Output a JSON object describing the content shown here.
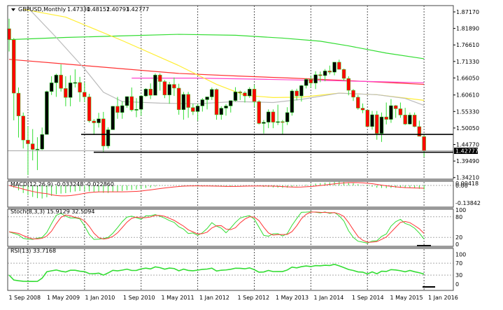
{
  "header": {
    "symbol": "GBPUSD,Monthly",
    "open": "1.47330",
    "high": "1.48152",
    "low": "1.40793",
    "close": "1.42777"
  },
  "current_price_label": "1.42777",
  "colors": {
    "bull_body": "#000000",
    "bear_body": "#ff0000",
    "wick": "#33dd33",
    "ma_green": "#33dd33",
    "ma_red": "#ff3333",
    "ma_pink": "#ff44cc",
    "ma_yellow": "#ffee33",
    "ma_gray": "#bbbbbb"
  },
  "chart_data": {
    "type": "candlestick",
    "title": "GBPUSD,Monthly",
    "price_ticks": [
      "1.87170",
      "1.81890",
      "1.76610",
      "1.71330",
      "1.66050",
      "1.60610",
      "1.55330",
      "1.50050",
      "1.44770",
      "1.39490",
      "1.34210"
    ],
    "price_tick_values": [
      1.8717,
      1.8189,
      1.7661,
      1.7133,
      1.6605,
      1.6061,
      1.5533,
      1.5005,
      1.4477,
      1.3949,
      1.3421
    ],
    "date_labels": [
      "1 Sep 2008",
      "1 May 2009",
      "1 Jan 2010",
      "1 Sep 2010",
      "1 May 2011",
      "1 Jan 2012",
      "1 Sep 2012",
      "1 May 2013",
      "1 Jan 2014",
      "1 Sep 2014",
      "1 May 2015",
      "1 Jan 2016"
    ],
    "first_bar": "2008-09",
    "ohlc": [
      [
        1.818,
        1.85,
        1.745,
        1.783
      ],
      [
        1.783,
        1.788,
        1.525,
        1.612
      ],
      [
        1.612,
        1.63,
        1.47,
        1.539
      ],
      [
        1.539,
        1.55,
        1.435,
        1.462
      ],
      [
        1.462,
        1.505,
        1.35,
        1.45
      ],
      [
        1.45,
        1.497,
        1.397,
        1.432
      ],
      [
        1.432,
        1.471,
        1.366,
        1.433
      ],
      [
        1.433,
        1.502,
        1.43,
        1.48
      ],
      [
        1.48,
        1.62,
        1.48,
        1.617
      ],
      [
        1.617,
        1.666,
        1.606,
        1.645
      ],
      [
        1.645,
        1.674,
        1.6,
        1.67
      ],
      [
        1.67,
        1.704,
        1.617,
        1.627
      ],
      [
        1.627,
        1.666,
        1.57,
        1.598
      ],
      [
        1.598,
        1.669,
        1.57,
        1.645
      ],
      [
        1.645,
        1.688,
        1.63,
        1.646
      ],
      [
        1.646,
        1.664,
        1.584,
        1.615
      ],
      [
        1.615,
        1.646,
        1.583,
        1.6
      ],
      [
        1.6,
        1.61,
        1.518,
        1.523
      ],
      [
        1.523,
        1.529,
        1.478,
        1.517
      ],
      [
        1.517,
        1.549,
        1.502,
        1.53
      ],
      [
        1.53,
        1.552,
        1.423,
        1.443
      ],
      [
        1.443,
        1.503,
        1.435,
        1.495
      ],
      [
        1.495,
        1.571,
        1.495,
        1.57
      ],
      [
        1.57,
        1.6,
        1.53,
        1.55
      ],
      [
        1.55,
        1.586,
        1.53,
        1.572
      ],
      [
        1.572,
        1.6,
        1.565,
        1.601
      ],
      [
        1.601,
        1.63,
        1.553,
        1.558
      ],
      [
        1.558,
        1.596,
        1.535,
        1.56
      ],
      [
        1.56,
        1.606,
        1.54,
        1.603
      ],
      [
        1.603,
        1.628,
        1.6,
        1.625
      ],
      [
        1.625,
        1.643,
        1.593,
        1.605
      ],
      [
        1.605,
        1.675,
        1.605,
        1.67
      ],
      [
        1.67,
        1.675,
        1.62,
        1.649
      ],
      [
        1.649,
        1.654,
        1.596,
        1.606
      ],
      [
        1.606,
        1.648,
        1.578,
        1.64
      ],
      [
        1.64,
        1.662,
        1.603,
        1.628
      ],
      [
        1.628,
        1.642,
        1.543,
        1.559
      ],
      [
        1.559,
        1.616,
        1.527,
        1.608
      ],
      [
        1.608,
        1.616,
        1.533,
        1.566
      ],
      [
        1.566,
        1.578,
        1.542,
        1.553
      ],
      [
        1.553,
        1.578,
        1.524,
        1.571
      ],
      [
        1.571,
        1.596,
        1.553,
        1.591
      ],
      [
        1.591,
        1.6,
        1.56,
        1.6
      ],
      [
        1.6,
        1.63,
        1.59,
        1.624
      ],
      [
        1.624,
        1.627,
        1.527,
        1.543
      ],
      [
        1.543,
        1.57,
        1.527,
        1.564
      ],
      [
        1.564,
        1.577,
        1.54,
        1.571
      ],
      [
        1.571,
        1.589,
        1.55,
        1.588
      ],
      [
        1.588,
        1.631,
        1.585,
        1.616
      ],
      [
        1.616,
        1.62,
        1.59,
        1.613
      ],
      [
        1.613,
        1.618,
        1.582,
        1.603
      ],
      [
        1.603,
        1.631,
        1.597,
        1.625
      ],
      [
        1.625,
        1.638,
        1.569,
        1.585
      ],
      [
        1.585,
        1.589,
        1.512,
        1.515
      ],
      [
        1.515,
        1.526,
        1.483,
        1.519
      ],
      [
        1.519,
        1.56,
        1.5,
        1.552
      ],
      [
        1.552,
        1.56,
        1.5,
        1.519
      ],
      [
        1.519,
        1.575,
        1.51,
        1.521
      ],
      [
        1.521,
        1.526,
        1.481,
        1.52
      ],
      [
        1.52,
        1.567,
        1.51,
        1.55
      ],
      [
        1.55,
        1.624,
        1.54,
        1.619
      ],
      [
        1.619,
        1.626,
        1.589,
        1.603
      ],
      [
        1.603,
        1.638,
        1.585,
        1.636
      ],
      [
        1.636,
        1.66,
        1.627,
        1.656
      ],
      [
        1.656,
        1.667,
        1.63,
        1.644
      ],
      [
        1.644,
        1.682,
        1.625,
        1.671
      ],
      [
        1.671,
        1.681,
        1.647,
        1.668
      ],
      [
        1.668,
        1.689,
        1.65,
        1.683
      ],
      [
        1.683,
        1.7,
        1.672,
        1.679
      ],
      [
        1.679,
        1.711,
        1.669,
        1.711
      ],
      [
        1.711,
        1.719,
        1.688,
        1.688
      ],
      [
        1.688,
        1.69,
        1.652,
        1.659
      ],
      [
        1.659,
        1.666,
        1.605,
        1.621
      ],
      [
        1.621,
        1.625,
        1.587,
        1.599
      ],
      [
        1.599,
        1.606,
        1.559,
        1.564
      ],
      [
        1.564,
        1.579,
        1.548,
        1.558
      ],
      [
        1.558,
        1.558,
        1.504,
        1.505
      ],
      [
        1.505,
        1.555,
        1.495,
        1.543
      ],
      [
        1.543,
        1.555,
        1.463,
        1.483
      ],
      [
        1.483,
        1.55,
        1.456,
        1.536
      ],
      [
        1.536,
        1.582,
        1.512,
        1.528
      ],
      [
        1.528,
        1.593,
        1.517,
        1.572
      ],
      [
        1.572,
        1.574,
        1.533,
        1.562
      ],
      [
        1.562,
        1.582,
        1.533,
        1.542
      ],
      [
        1.542,
        1.565,
        1.51,
        1.513
      ],
      [
        1.513,
        1.55,
        1.511,
        1.542
      ],
      [
        1.542,
        1.55,
        1.503,
        1.505
      ],
      [
        1.505,
        1.524,
        1.475,
        1.474
      ],
      [
        1.4733,
        1.48152,
        1.40793,
        1.42777
      ]
    ],
    "moving_averages": [
      {
        "name": "ma-green",
        "color": "#33dd33",
        "points": [
          [
            0,
            1.783
          ],
          [
            12,
            1.79
          ],
          [
            24,
            1.795
          ],
          [
            36,
            1.8
          ],
          [
            48,
            1.797
          ],
          [
            58,
            1.788
          ],
          [
            66,
            1.778
          ],
          [
            72,
            1.763
          ],
          [
            80,
            1.74
          ],
          [
            88,
            1.722
          ]
        ]
      },
      {
        "name": "ma-red",
        "color": "#ff3333",
        "points": [
          [
            0,
            1.72
          ],
          [
            12,
            1.705
          ],
          [
            24,
            1.69
          ],
          [
            36,
            1.675
          ],
          [
            48,
            1.667
          ],
          [
            60,
            1.66
          ],
          [
            72,
            1.652
          ],
          [
            80,
            1.646
          ],
          [
            88,
            1.64
          ]
        ]
      },
      {
        "name": "ma-pink",
        "color": "#ff44cc",
        "points": [
          [
            26,
            1.66
          ],
          [
            40,
            1.66
          ],
          [
            55,
            1.656
          ],
          [
            68,
            1.652
          ],
          [
            80,
            1.648
          ],
          [
            88,
            1.645
          ]
        ]
      },
      {
        "name": "ma-yellow",
        "color": "#ffee33",
        "points": [
          [
            3,
            1.88
          ],
          [
            12,
            1.855
          ],
          [
            24,
            1.78
          ],
          [
            36,
            1.7
          ],
          [
            44,
            1.64
          ],
          [
            50,
            1.605
          ],
          [
            56,
            1.598
          ],
          [
            62,
            1.599
          ],
          [
            70,
            1.612
          ],
          [
            78,
            1.607
          ],
          [
            88,
            1.589
          ]
        ]
      },
      {
        "name": "ma-gray",
        "color": "#bbbbbb",
        "points": [
          [
            4,
            1.885
          ],
          [
            10,
            1.79
          ],
          [
            16,
            1.69
          ],
          [
            20,
            1.615
          ],
          [
            24,
            1.585
          ],
          [
            32,
            1.58
          ],
          [
            40,
            1.578
          ],
          [
            48,
            1.585
          ],
          [
            56,
            1.582
          ],
          [
            62,
            1.592
          ],
          [
            70,
            1.612
          ],
          [
            78,
            1.607
          ],
          [
            84,
            1.595
          ],
          [
            88,
            1.573
          ]
        ]
      }
    ],
    "support_lines": [
      1.48,
      1.423
    ],
    "macd": {
      "label": "MACD(12,26,9) -0.033248 -0.022860",
      "ticks": [
        "0.00",
        "0.00418",
        "-0.13842"
      ],
      "ylim": [
        -0.16,
        0.01
      ]
    },
    "stoch": {
      "label": "Stoch(8,3,3) 15.9129 32.5094",
      "ticks": [
        "100",
        "80",
        "20",
        "0"
      ],
      "levels": [
        80,
        20
      ]
    },
    "rsi": {
      "label": "RSI(13) 33.7168",
      "ticks": [
        "100",
        "70",
        "30",
        "0"
      ],
      "levels": [
        70,
        30
      ]
    }
  }
}
